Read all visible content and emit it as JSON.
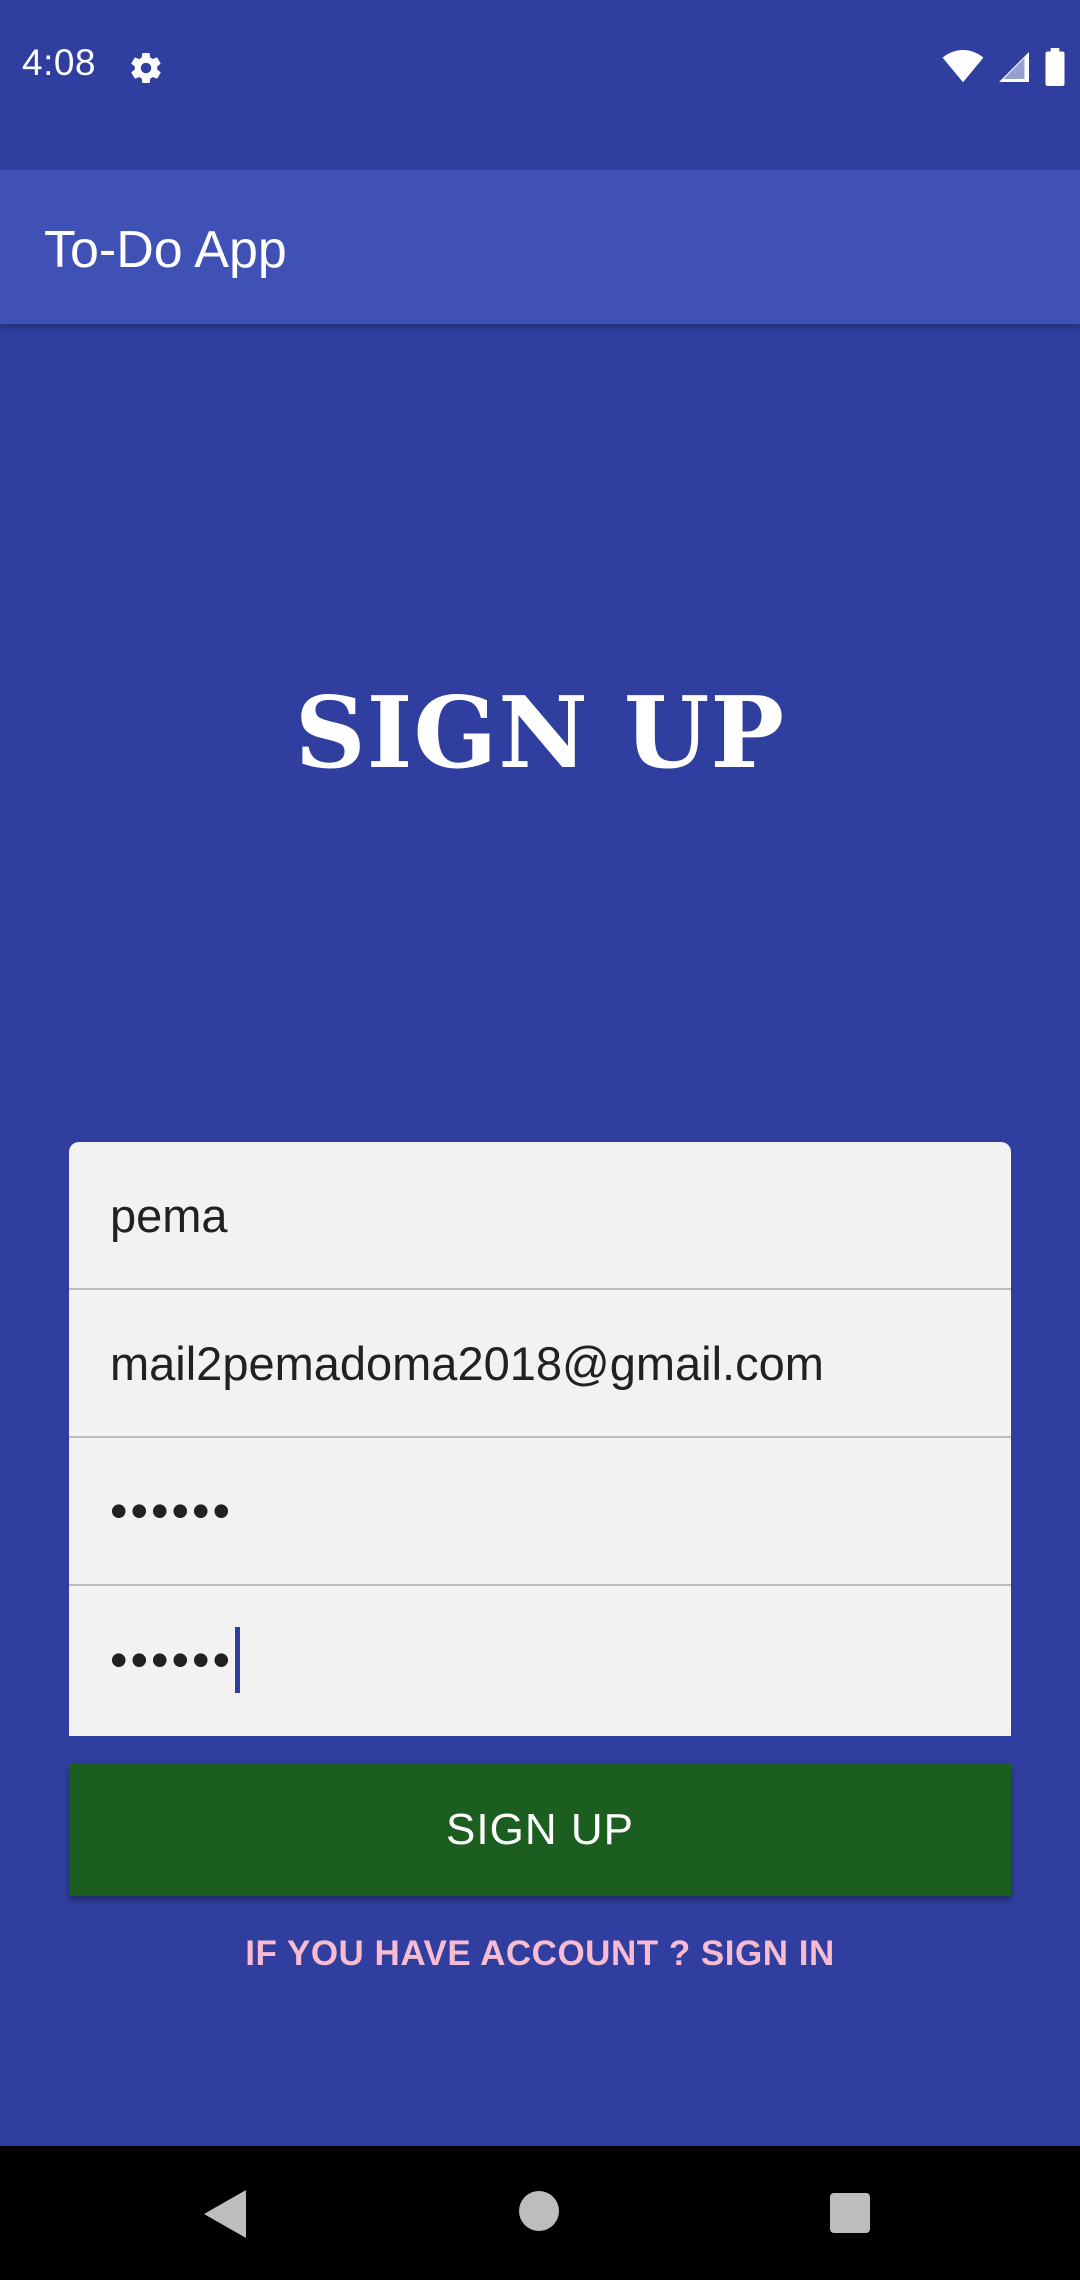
{
  "status_bar": {
    "time": "4:08",
    "icons": [
      "gear-icon",
      "wifi-icon",
      "signal-icon",
      "battery-icon"
    ]
  },
  "app_bar": {
    "title": "To-Do App"
  },
  "main": {
    "heading": "SIGN UP",
    "fields": {
      "name": "pema",
      "email": "mail2pemadoma2018@gmail.com",
      "password": "••••••",
      "confirm_password": "••••••"
    },
    "signup_button": "SIGN UP",
    "signin_link": "IF YOU HAVE ACCOUNT ? SIGN IN"
  },
  "nav_bar": {
    "icons": [
      "back-icon",
      "home-icon",
      "recents-icon"
    ]
  },
  "colors": {
    "background": "#303F9F",
    "app_bar": "#3F51B5",
    "button": "#1B5E20",
    "link": "#F8BBD0"
  }
}
